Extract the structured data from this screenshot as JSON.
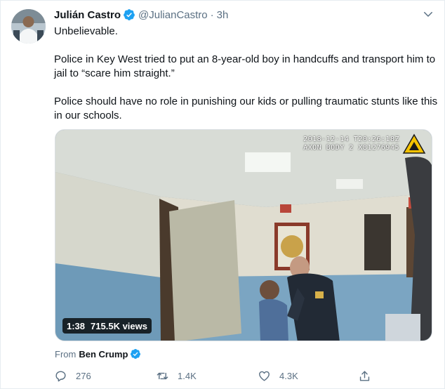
{
  "tweet": {
    "name": "Julián Castro",
    "handle": "@JulianCastro",
    "dot": "·",
    "time": "3h",
    "paragraphs": [
      "Unbelievable.",
      "Police in Key West tried to put an 8-year-old boy in handcuffs and transport him to jail to “scare him straight.”",
      "Police should have no role in punishing our kids or pulling traumatic stunts like this in our schools."
    ]
  },
  "media": {
    "overlay_line1": "2018-12-14 T20:26:18Z",
    "overlay_line2": "AXON BODY 2 X81276945",
    "duration": "1:38",
    "views": "715.5K views"
  },
  "source": {
    "prefix": "From",
    "name": "Ben Crump"
  },
  "actions": {
    "replies": "276",
    "retweets": "1.4K",
    "likes": "4.3K"
  },
  "colors": {
    "verified": "#1da1f2",
    "secondary_text": "#5b7083",
    "primary_text": "#0f1419"
  },
  "icons": [
    "verified-badge-icon",
    "chevron-down-icon",
    "reply-icon",
    "retweet-icon",
    "like-icon",
    "share-icon"
  ]
}
